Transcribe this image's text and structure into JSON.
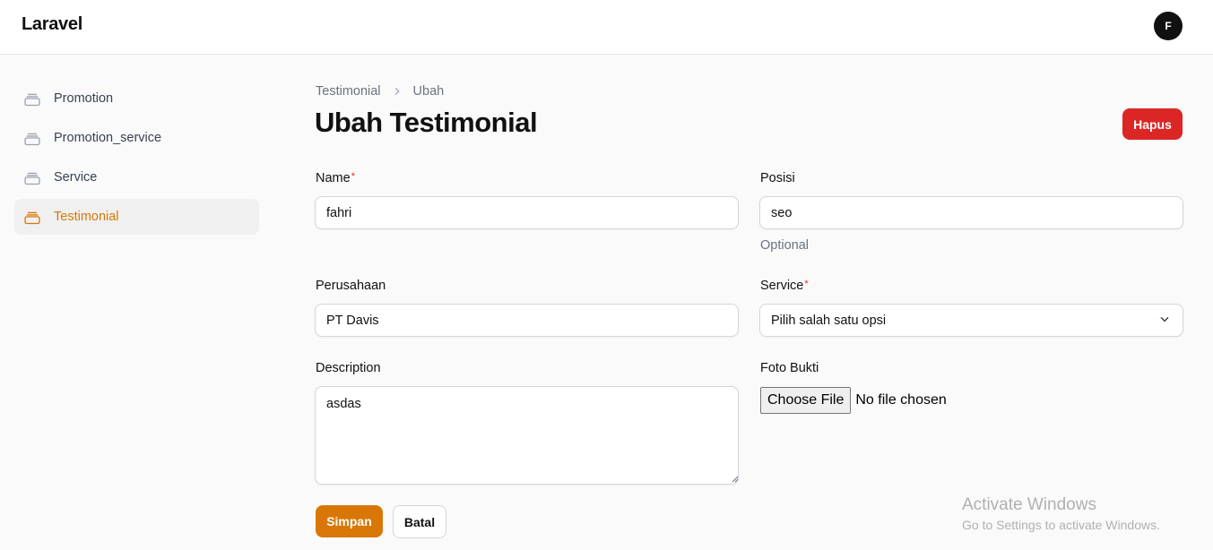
{
  "app": {
    "brand": "Laravel",
    "user_initial": "F"
  },
  "sidebar": {
    "items": [
      {
        "label": "Promotion",
        "icon": "rectangle-stack-icon",
        "active": false
      },
      {
        "label": "Promotion_service",
        "icon": "rectangle-stack-icon",
        "active": false
      },
      {
        "label": "Service",
        "icon": "rectangle-stack-icon",
        "active": false
      },
      {
        "label": "Testimonial",
        "icon": "rectangle-stack-icon",
        "active": true
      }
    ]
  },
  "breadcrumb": {
    "parent": "Testimonial",
    "current": "Ubah"
  },
  "page": {
    "title": "Ubah Testimonial",
    "delete_label": "Hapus"
  },
  "form": {
    "name": {
      "label": "Name",
      "required_mark": "*",
      "value": "fahri"
    },
    "posisi": {
      "label": "Posisi",
      "value": "seo",
      "helper": "Optional"
    },
    "perusahaan": {
      "label": "Perusahaan",
      "value": "PT Davis"
    },
    "service": {
      "label": "Service",
      "required_mark": "*",
      "selected": "Pilih salah satu opsi"
    },
    "description": {
      "label": "Description",
      "value": "asdas"
    },
    "foto": {
      "label": "Foto Bukti",
      "button_label": "Choose File",
      "status": "No file chosen"
    },
    "save_label": "Simpan",
    "cancel_label": "Batal"
  },
  "watermark": {
    "title": "Activate Windows",
    "subtitle": "Go to Settings to activate Windows."
  },
  "colors": {
    "primary": "#d97706",
    "danger": "#dc2626",
    "text": "#111827",
    "muted": "#6b7280",
    "background": "#fafafa"
  }
}
